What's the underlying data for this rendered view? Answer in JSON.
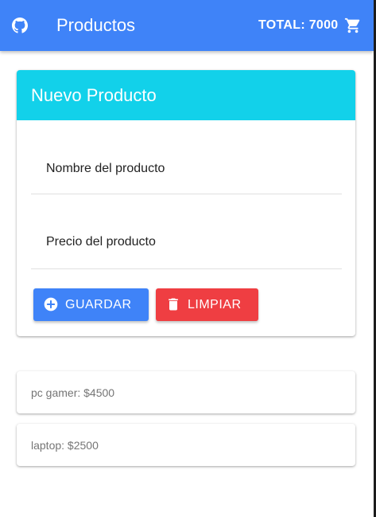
{
  "appbar": {
    "title": "Productos",
    "total": "TOTAL: 7000",
    "github_icon": "github-icon",
    "cart_icon": "shopping-cart-icon",
    "color": "#3f83f8"
  },
  "form": {
    "header": "Nuevo Producto",
    "header_color": "#12d1ea",
    "name_label": "Nombre del producto",
    "price_label": "Precio del producto",
    "save_label": "GUARDAR",
    "save_icon": "plus-circle-icon",
    "save_color": "#3f83f8",
    "clear_label": "LIMPIAR",
    "clear_icon": "trash-icon",
    "clear_color": "#ef3e42"
  },
  "products": [
    {
      "text": "pc gamer: $4500"
    },
    {
      "text": "laptop: $2500"
    }
  ]
}
